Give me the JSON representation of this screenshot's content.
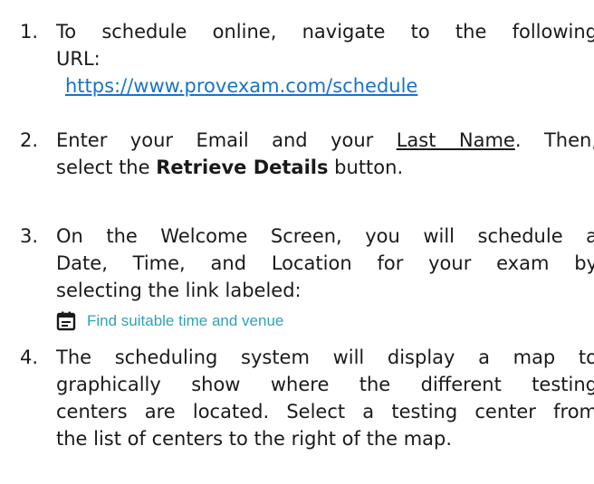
{
  "steps": [
    {
      "num": "1.",
      "line1": "To schedule online, navigate to the following",
      "line2": "URL:",
      "url": "https://www.provexam.com/schedule"
    },
    {
      "num": "2.",
      "pre": "Enter your Email and your ",
      "underlined": "Last Name",
      "post": ".  Then,",
      "line2_pre": "select the ",
      "bold": "Retrieve Details",
      "line2_post": " button."
    },
    {
      "num": "3.",
      "line1": "On the Welcome Screen, you will schedule a",
      "line2": "Date, Time, and Location for your exam by",
      "line3": "selecting the link labeled:",
      "link_icon": "calendar-icon",
      "link_text": "Find suitable time and venue"
    },
    {
      "num": "4.",
      "line1": "The scheduling system will display a map to",
      "line2": "graphically show where the different testing",
      "line3": "centers are located.  Select a testing center from",
      "line4": "the list of centers to the right of the map."
    }
  ],
  "colors": {
    "link": "#1a73c8",
    "venue_link": "#2fa3b4",
    "text": "#1a1a1a"
  }
}
